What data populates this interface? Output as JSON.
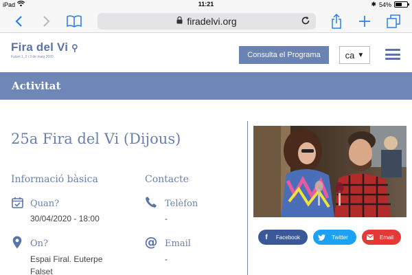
{
  "status_bar": {
    "device": "iPad",
    "time": "11:21",
    "battery": "54%",
    "battery_level": 0.54
  },
  "browser": {
    "url": "firadelvi.org",
    "icons": [
      "back-icon",
      "forward-icon",
      "bookmarks-icon",
      "lock-icon",
      "reload-icon",
      "share-icon",
      "new-tab-icon",
      "tabs-icon"
    ]
  },
  "header": {
    "logo_text": "Fira del Vi",
    "logo_sub": "Falset 1, 2 i 3 de maig 2020",
    "program_button": "Consulta el Programa",
    "language": "ca",
    "colors": {
      "brand": "#5a73a8",
      "band": "#6f87b6"
    }
  },
  "section": {
    "title": "Activitat"
  },
  "event": {
    "title": "25a Fira del Vi (Dijous)",
    "basic_info_heading": "Informació bàsica",
    "contact_heading": "Contacte",
    "when_label": "Quan?",
    "when_value": "30/04/2020 - 18:00",
    "where_label": "On?",
    "where_value_line1": "Espai Firal. Euterpe",
    "where_value_line2": "Falset",
    "phone_label": "Telèfon",
    "phone_value": "-",
    "email_label": "Email",
    "email_value": "-"
  },
  "share": {
    "facebook": {
      "label": "Facebook",
      "color": "#3b5998"
    },
    "twitter": {
      "label": "Twitter",
      "color": "#1da1f2"
    },
    "email": {
      "label": "Email",
      "color": "#e53935"
    }
  }
}
